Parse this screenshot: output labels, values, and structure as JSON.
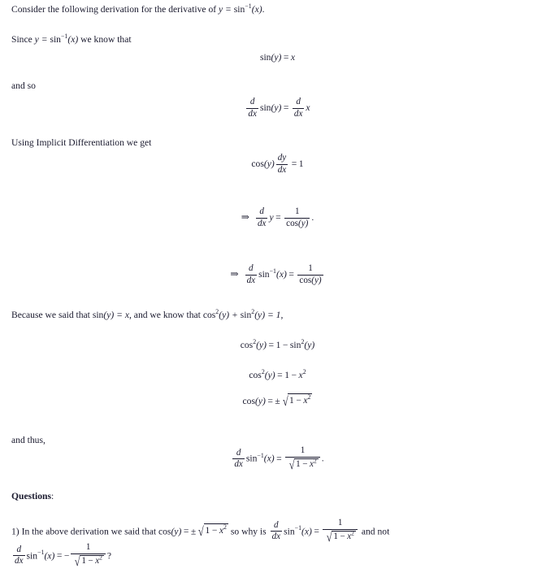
{
  "document": {
    "type": "calculus-derivation-worksheet",
    "topic": "Derivative of arcsine",
    "text_color": "#1a1a2e",
    "background_color": "#ffffff"
  },
  "intro": {
    "lead": "Consider the following derivation for the derivative of ",
    "y_eq": "y = ",
    "sin": "sin",
    "inv": "−1",
    "arg": "(x)",
    "period": "."
  },
  "lines": {
    "since_prefix": "Since ",
    "since_y": "y = ",
    "since_sin": "sin",
    "since_inv": "−1",
    "since_arg": "(x)",
    "since_suffix": " we know that",
    "and_so": "and so",
    "implicit": "Using Implicit Differentiation we get",
    "because_a": "Because we said that ",
    "because_sin": "sin",
    "because_argy": "(y) = ",
    "because_x": "x",
    "because_b": ", and we know that ",
    "because_cos": "cos",
    "because_cos_sq": "2",
    "because_cos_arg": "(y) + ",
    "because_sin2": "sin",
    "because_sin_sq": "2",
    "because_sin_arg": "(y) = 1,",
    "and_thus": "and thus,",
    "questions_label": "Questions",
    "questions_colon": ":"
  },
  "equations": {
    "eq1": {
      "id": "sin-y-equals-x",
      "latex": "\\sin(y) = x",
      "parts": {
        "sin": "sin",
        "arg": "(y)",
        "eq": "=",
        "rhs": "x"
      }
    },
    "eq2": {
      "id": "d-dx-sin-y-equals-d-dx-x",
      "latex": "\\frac{d}{dx}\\sin(y) = \\frac{d}{dx}x",
      "parts": {
        "num": "d",
        "den": "dx",
        "sin": "sin",
        "arg": "(y)",
        "eq": "=",
        "num2": "d",
        "den2": "dx",
        "rhs": "x"
      }
    },
    "eq3": {
      "id": "cos-y-dydx-equals-1",
      "latex": "\\cos(y)\\frac{dy}{dx} = 1",
      "parts": {
        "cos": "cos",
        "arg": "(y)",
        "num": "dy",
        "den": "dx",
        "eq": "=",
        "rhs": "1"
      }
    },
    "eq4": {
      "id": "implies-d-dx-y-equals-1-over-cos-y",
      "latex": "\\Rightarrow \\frac{d}{dx}y = \\frac{1}{\\cos(y)}.",
      "parts": {
        "arrow": "⇒",
        "num": "d",
        "den": "dx",
        "var": "y",
        "eq": "=",
        "rnum": "1",
        "rcos": "cos",
        "rarg": "(y)",
        "period": "."
      }
    },
    "eq5": {
      "id": "implies-d-dx-arcsin-equals-1-over-cos-y",
      "latex": "\\Rightarrow \\frac{d}{dx}\\sin^{-1}(x) = \\frac{1}{\\cos(y)}",
      "parts": {
        "arrow": "⇒",
        "num": "d",
        "den": "dx",
        "sin": "sin",
        "inv": "−1",
        "arg": "(x)",
        "eq": "=",
        "rnum": "1",
        "rcos": "cos",
        "rarg": "(y)"
      }
    },
    "eq6": {
      "id": "cos2-equals-1-minus-sin2",
      "latex": "\\cos^2(y) = 1 - \\sin^2(y)",
      "parts": {
        "cos": "cos",
        "sq": "2",
        "arg": "(y)",
        "eq": "=",
        "one": "1",
        "minus": "−",
        "sin": "sin",
        "sq2": "2",
        "arg2": "(y)"
      }
    },
    "eq7": {
      "id": "cos2-equals-1-minus-x2",
      "latex": "\\cos^2(y) = 1 - x^2",
      "parts": {
        "cos": "cos",
        "sq": "2",
        "arg": "(y)",
        "eq": "=",
        "one": "1",
        "minus": "−",
        "x": "x",
        "xsq": "2"
      }
    },
    "eq8": {
      "id": "cos-equals-plusminus-sqrt-1-minus-x2",
      "latex": "\\cos(y) = \\pm\\sqrt{1-x^2}",
      "parts": {
        "cos": "cos",
        "arg": "(y)",
        "eq": "=",
        "pm": "±",
        "radical": "√",
        "one": "1",
        "minus": "−",
        "x": "x",
        "xsq": "2"
      }
    },
    "eq9": {
      "id": "final-derivative-arcsin",
      "latex": "\\frac{d}{dx}\\sin^{-1}(x) = \\frac{1}{\\sqrt{1-x^2}}.",
      "parts": {
        "num": "d",
        "den": "dx",
        "sin": "sin",
        "inv": "−1",
        "arg": "(x)",
        "eq": "=",
        "rnum": "1",
        "radical": "√",
        "one": "1",
        "minus": "−",
        "x": "x",
        "xsq": "2",
        "period": "."
      }
    }
  },
  "question": {
    "number": "1)",
    "seg_a": "In the above derivation we said that ",
    "cos": "cos",
    "cos_arg": "(y)",
    "eq1": "=",
    "pm": "±",
    "radical": "√",
    "one": "1",
    "minus": "−",
    "x": "x",
    "xsq": "2",
    "seg_b": "so why is",
    "d": "d",
    "dx": "dx",
    "sin": "sin",
    "inv": "−1",
    "sin_arg": "(x)",
    "eq2": "=",
    "rnum": "1",
    "seg_c": "and not",
    "d2": "d",
    "dx2": "dx",
    "sin2": "sin",
    "inv2": "−1",
    "sin_arg2": "(x)",
    "eq3": "=",
    "neg": "−",
    "rnum2": "1",
    "qmark": "?"
  }
}
